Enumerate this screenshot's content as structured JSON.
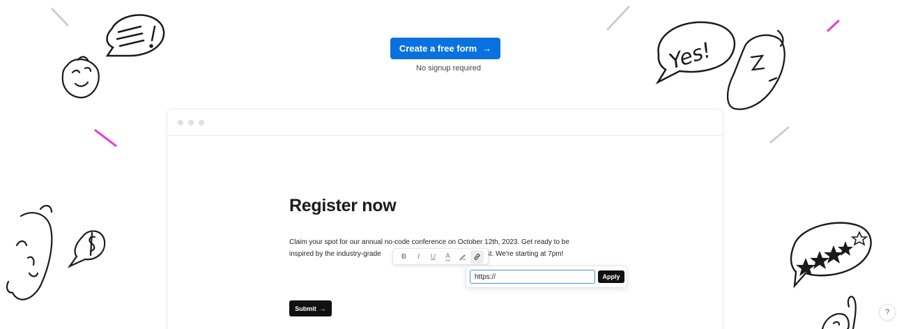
{
  "cta": {
    "label": "Create a free form",
    "arrow": "→",
    "subtext": "No signup required",
    "color": "#0a72e0"
  },
  "form": {
    "title": "Register now",
    "description_line1": "Claim your spot for our annual no-code conference on October 12th, 2023. Get ready to be",
    "description_line2_start": "inspired by the industry-grade",
    "description_line2_end": "he best. We're starting at 7pm!",
    "submit_label": "Submit",
    "submit_arrow": "→"
  },
  "toolbar": {
    "bold": "B",
    "italic": "I",
    "underline": "U",
    "text_color": "A",
    "icons": [
      "bold-icon",
      "italic-icon",
      "underline-icon",
      "text-color-icon",
      "highlight-icon",
      "link-icon"
    ]
  },
  "link_popup": {
    "input_value": "https://",
    "apply_label": "Apply"
  },
  "doodles": {
    "speech_text": "Yes!",
    "icons": [
      "speech-bubble-icon",
      "face-doodle-icon",
      "dollar-bubble-icon",
      "stars-bubble-icon",
      "zzz-face-doodle-icon"
    ]
  },
  "help": {
    "label": "?"
  },
  "colors": {
    "accent": "#0a72e0",
    "doodle_pink": "#e83ccf",
    "dark": "#111111"
  }
}
